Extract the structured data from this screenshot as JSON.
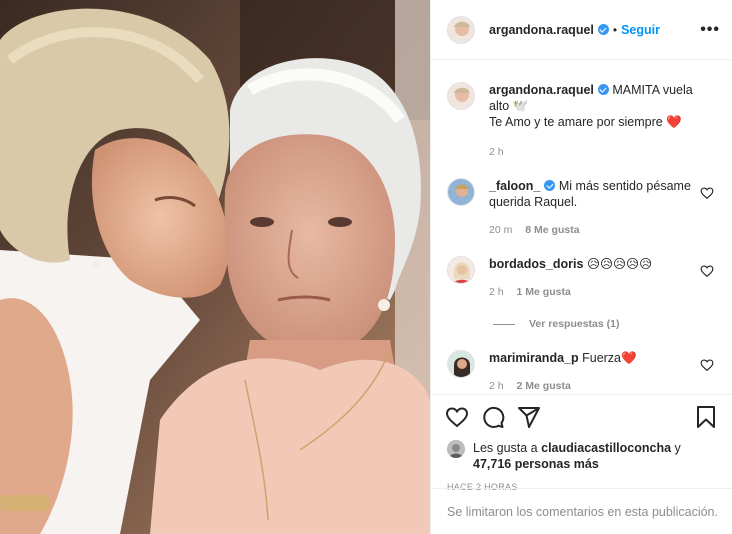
{
  "header": {
    "username": "argandona.raquel",
    "separator": "•",
    "follow_label": "Seguir",
    "more_label": "•••"
  },
  "caption": {
    "username": "argandona.raquel",
    "text_line1": "MAMITA vuela alto 🕊️",
    "text_line2": "Te Amo y te amare por siempre ❤️",
    "time": "2 h"
  },
  "comments": [
    {
      "username": "_faloon_",
      "text": "Mi más sentido pésame querida Raquel.",
      "time": "20 m",
      "likes": "8 Me gusta"
    },
    {
      "username": "bordados_doris",
      "text": "😥😥😥😥😥",
      "time": "2 h",
      "likes": "1 Me gusta"
    },
    {
      "username": "marimiranda_p",
      "text": "Fuerza❤️",
      "time": "2 h",
      "likes": "2 Me gusta"
    }
  ],
  "view_replies": "Ver respuestas (1)",
  "liked_by": {
    "prefix": "Les gusta a",
    "user": "claudiacastilloconcha",
    "connector": "y",
    "others": "47,716 personas más"
  },
  "timestamp": "HACE 2 HORAS",
  "comments_limited": "Se limitaron los comentarios en esta publicación.",
  "icons": {
    "like": "heart-icon",
    "comment": "comment-icon",
    "share": "share-icon",
    "save": "bookmark-icon",
    "verified": "verified-badge-icon"
  },
  "colors": {
    "accent": "#0095f6",
    "verified": "#3897f0",
    "muted": "#8e8e8e",
    "text": "#262626"
  }
}
